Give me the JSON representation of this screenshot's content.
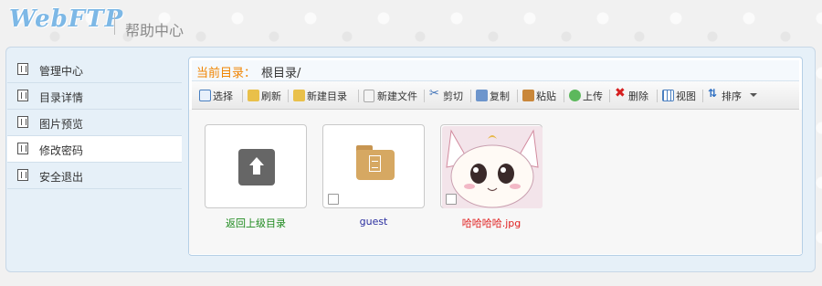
{
  "header": {
    "logo": "WebFTP",
    "help_center": "帮助中心"
  },
  "sidebar": {
    "items": [
      {
        "label": "管理中心",
        "active": false
      },
      {
        "label": "目录详情",
        "active": false
      },
      {
        "label": "图片预览",
        "active": false
      },
      {
        "label": "修改密码",
        "active": true
      },
      {
        "label": "安全退出",
        "active": false
      }
    ]
  },
  "path": {
    "label": "当前目录：",
    "value": "根目录/"
  },
  "toolbar": {
    "select": "选择",
    "refresh": "刷新",
    "new_dir": "新建目录",
    "new_file": "新建文件",
    "cut": "剪切",
    "copy": "复制",
    "paste": "粘贴",
    "upload": "上传",
    "delete": "删除",
    "view": "视图",
    "sort": "排序"
  },
  "files": [
    {
      "name": "返回上级目录",
      "kind": "parent",
      "name_color": "#1e8a1e"
    },
    {
      "name": "guest",
      "kind": "folder",
      "name_color": "#2b2fa0"
    },
    {
      "name": "哈哈哈哈.jpg",
      "kind": "image",
      "name_color": "#e02020"
    }
  ],
  "colors": {
    "accent_orange": "#f08400",
    "panel_bg": "#e6f0f8"
  }
}
